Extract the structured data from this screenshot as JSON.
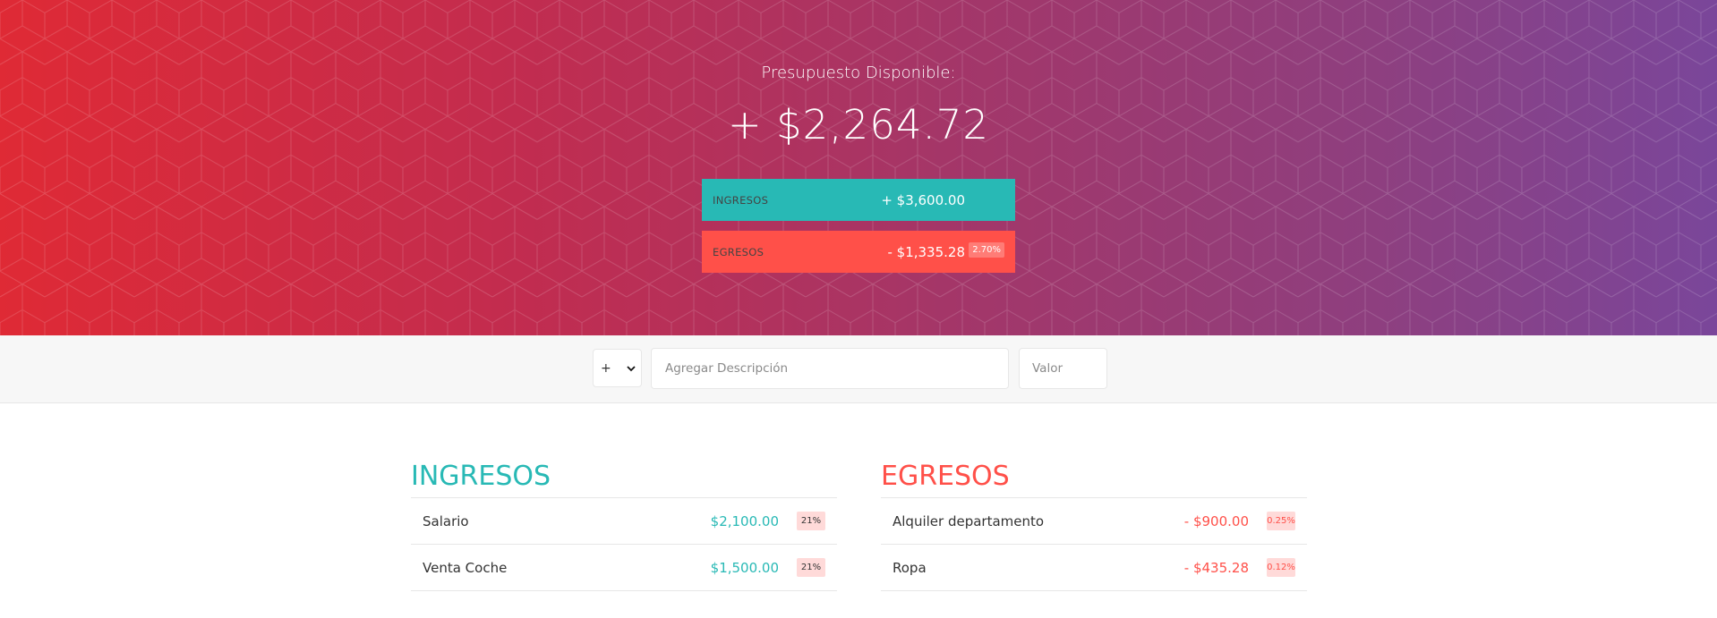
{
  "header": {
    "title": "Presupuesto Disponible:",
    "budget": "+ $2,264.72",
    "income": {
      "label": "Ingresos",
      "value": "+ $3,600.00"
    },
    "expenses": {
      "label": "Egresos",
      "value": "- $1,335.28",
      "percentage": "2.70%"
    }
  },
  "add_form": {
    "type_options": [
      "+",
      "-"
    ],
    "type_selected": "+",
    "description_placeholder": "Agregar Descripción",
    "value_placeholder": "Valor"
  },
  "income_list": {
    "title": "Ingresos",
    "items": [
      {
        "description": "Salario",
        "value": "$2,100.00",
        "percentage": "21%"
      },
      {
        "description": "Venta Coche",
        "value": "$1,500.00",
        "percentage": "21%"
      }
    ]
  },
  "expense_list": {
    "title": "Egresos",
    "items": [
      {
        "description": "Alquiler departamento",
        "value": "- $900.00",
        "percentage": "0.25%"
      },
      {
        "description": "Ropa",
        "value": "- $435.28",
        "percentage": "0.12%"
      }
    ]
  },
  "colors": {
    "income": "#28b9b5",
    "expense": "#ff5049",
    "gradient_start": "#df2a35",
    "gradient_end": "#7a469a"
  },
  "icons": {
    "select_arrow": "chevron-down-icon"
  }
}
